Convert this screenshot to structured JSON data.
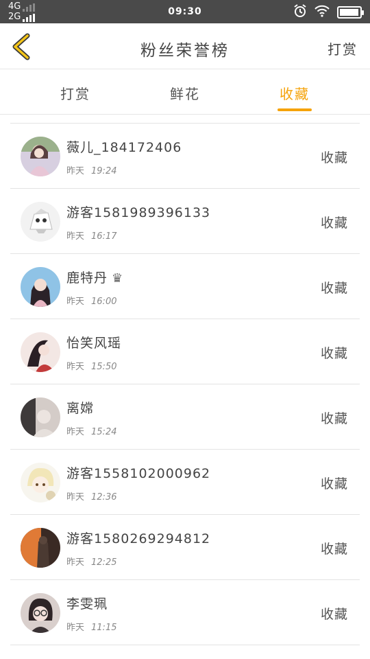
{
  "status_bar": {
    "network_top": "4G",
    "network_bottom": "2G",
    "time": "09:30",
    "battery_level": 0.98,
    "icons": [
      "alarm-icon",
      "wifi-icon",
      "battery-icon"
    ]
  },
  "header": {
    "title": "粉丝荣誉榜",
    "action_label": "打赏",
    "back_icon": "chevron-left-icon",
    "accent_color": "#f5a30a"
  },
  "tabs": [
    {
      "label": "打赏",
      "active": false
    },
    {
      "label": "鲜花",
      "active": false
    },
    {
      "label": "收藏",
      "active": true
    }
  ],
  "list": [
    {
      "name": "薇儿_184172406",
      "day": "昨天",
      "time": "19:24",
      "action": "收藏"
    },
    {
      "name": "游客1581989396133",
      "day": "昨天",
      "time": "16:17",
      "action": "收藏"
    },
    {
      "name": "鹿特丹",
      "badge": "crown-icon",
      "day": "昨天",
      "time": "16:00",
      "action": "收藏"
    },
    {
      "name": "怡笑风瑶",
      "day": "昨天",
      "time": "15:50",
      "action": "收藏"
    },
    {
      "name": "离嫦",
      "day": "昨天",
      "time": "15:24",
      "action": "收藏"
    },
    {
      "name": "游客1558102000962",
      "day": "昨天",
      "time": "12:36",
      "action": "收藏"
    },
    {
      "name": "游客1580269294812",
      "day": "昨天",
      "time": "12:25",
      "action": "收藏"
    },
    {
      "name": "李雯珮",
      "day": "昨天",
      "time": "11:15",
      "action": "收藏"
    }
  ]
}
